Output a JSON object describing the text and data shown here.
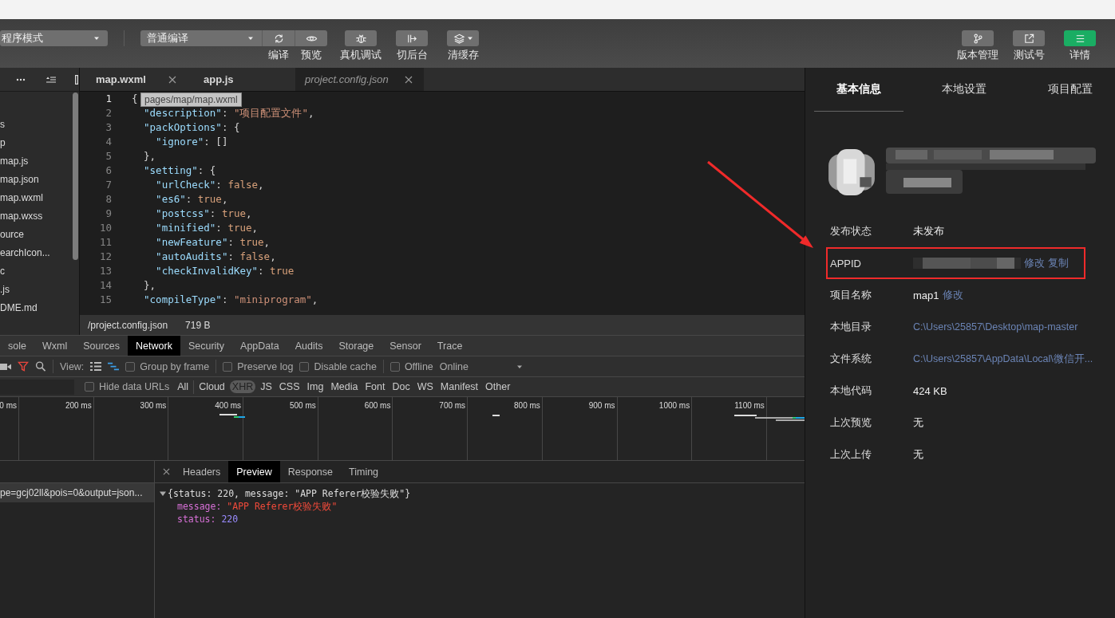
{
  "toolbar": {
    "mode_select": {
      "value": "程序模式"
    },
    "compile_select": {
      "value": "普通编译",
      "buttons": [
        {
          "label": "编译",
          "kind": "refresh"
        },
        {
          "label": "预览",
          "kind": "eye"
        }
      ]
    },
    "tools": [
      {
        "label": "真机调试",
        "kind": "bug"
      },
      {
        "label": "切后台",
        "kind": "exit"
      },
      {
        "label": "清缓存",
        "kind": "layers"
      }
    ],
    "right_tools": [
      {
        "label": "版本管理",
        "kind": "branch",
        "selected": false
      },
      {
        "label": "测试号",
        "kind": "external",
        "selected": false
      },
      {
        "label": "详情",
        "kind": "menu",
        "selected": true
      }
    ]
  },
  "file_tree": {
    "items": [
      "s",
      "p",
      "map.js",
      "map.json",
      "map.wxml",
      "map.wxss",
      "ource",
      "earchIcon...",
      "c",
      ".js",
      "DME.md"
    ]
  },
  "editor": {
    "tabs": [
      {
        "label": "map.wxml",
        "selected": false,
        "preview": false,
        "closable": true
      },
      {
        "label": "app.js",
        "selected": false,
        "preview": false,
        "closable": false
      },
      {
        "label": "project.config.json",
        "selected": true,
        "preview": true,
        "closable": true
      }
    ],
    "tooltip": "pages/map/map.wxml",
    "lines": [
      {
        "number": "1",
        "active": true,
        "tokens": [
          {
            "kind": "punct",
            "text": "{"
          }
        ]
      },
      {
        "number": "2",
        "active": false,
        "tokens": [
          {
            "kind": "key",
            "text": "  \"description\""
          },
          {
            "kind": "punct",
            "text": ": "
          },
          {
            "kind": "string",
            "text": "\"项目配置文件\""
          },
          {
            "kind": "punct",
            "text": ","
          }
        ]
      },
      {
        "number": "3",
        "active": false,
        "tokens": [
          {
            "kind": "key",
            "text": "  \"packOptions\""
          },
          {
            "kind": "punct",
            "text": ": {"
          }
        ]
      },
      {
        "number": "4",
        "active": false,
        "tokens": [
          {
            "kind": "key",
            "text": "    \"ignore\""
          },
          {
            "kind": "punct",
            "text": ": []"
          }
        ]
      },
      {
        "number": "5",
        "active": false,
        "tokens": [
          {
            "kind": "punct",
            "text": "  },"
          }
        ]
      },
      {
        "number": "6",
        "active": false,
        "tokens": [
          {
            "kind": "key",
            "text": "  \"setting\""
          },
          {
            "kind": "punct",
            "text": ": {"
          }
        ]
      },
      {
        "number": "7",
        "active": false,
        "tokens": [
          {
            "kind": "key",
            "text": "    \"urlCheck\""
          },
          {
            "kind": "punct",
            "text": ": "
          },
          {
            "kind": "literal",
            "text": "false"
          },
          {
            "kind": "punct",
            "text": ","
          }
        ]
      },
      {
        "number": "8",
        "active": false,
        "tokens": [
          {
            "kind": "key",
            "text": "    \"es6\""
          },
          {
            "kind": "punct",
            "text": ": "
          },
          {
            "kind": "literal",
            "text": "true"
          },
          {
            "kind": "punct",
            "text": ","
          }
        ]
      },
      {
        "number": "9",
        "active": false,
        "tokens": [
          {
            "kind": "key",
            "text": "    \"postcss\""
          },
          {
            "kind": "punct",
            "text": ": "
          },
          {
            "kind": "literal",
            "text": "true"
          },
          {
            "kind": "punct",
            "text": ","
          }
        ]
      },
      {
        "number": "10",
        "active": false,
        "tokens": [
          {
            "kind": "key",
            "text": "    \"minified\""
          },
          {
            "kind": "punct",
            "text": ": "
          },
          {
            "kind": "literal",
            "text": "true"
          },
          {
            "kind": "punct",
            "text": ","
          }
        ]
      },
      {
        "number": "11",
        "active": false,
        "tokens": [
          {
            "kind": "key",
            "text": "    \"newFeature\""
          },
          {
            "kind": "punct",
            "text": ": "
          },
          {
            "kind": "literal",
            "text": "true"
          },
          {
            "kind": "punct",
            "text": ","
          }
        ]
      },
      {
        "number": "12",
        "active": false,
        "tokens": [
          {
            "kind": "key",
            "text": "    \"autoAudits\""
          },
          {
            "kind": "punct",
            "text": ": "
          },
          {
            "kind": "literal",
            "text": "false"
          },
          {
            "kind": "punct",
            "text": ","
          }
        ]
      },
      {
        "number": "13",
        "active": false,
        "tokens": [
          {
            "kind": "key",
            "text": "    \"checkInvalidKey\""
          },
          {
            "kind": "punct",
            "text": ": "
          },
          {
            "kind": "literal",
            "text": "true"
          }
        ]
      },
      {
        "number": "14",
        "active": false,
        "tokens": [
          {
            "kind": "punct",
            "text": "  },"
          }
        ]
      },
      {
        "number": "15",
        "active": false,
        "tokens": [
          {
            "kind": "key",
            "text": "  \"compileType\""
          },
          {
            "kind": "punct",
            "text": ": "
          },
          {
            "kind": "string",
            "text": "\"miniprogram\""
          },
          {
            "kind": "punct",
            "text": ","
          }
        ]
      }
    ],
    "status": {
      "path": "/project.config.json",
      "size": "719 B"
    }
  },
  "devtools": {
    "tabs": [
      {
        "label": "sole",
        "selected": false
      },
      {
        "label": "Wxml",
        "selected": false
      },
      {
        "label": "Sources",
        "selected": false
      },
      {
        "label": "Network",
        "selected": true
      },
      {
        "label": "Security",
        "selected": false
      },
      {
        "label": "AppData",
        "selected": false
      },
      {
        "label": "Audits",
        "selected": false
      },
      {
        "label": "Storage",
        "selected": false
      },
      {
        "label": "Sensor",
        "selected": false
      },
      {
        "label": "Trace",
        "selected": false
      }
    ],
    "network_toolbar": {
      "filter_active": true,
      "view_label": "View:",
      "views": [
        {
          "kind": "list",
          "selected": false
        },
        {
          "kind": "waterfall",
          "selected": true
        }
      ],
      "options": [
        {
          "label": "Group by frame",
          "checked": false
        },
        {
          "label": "Preserve log",
          "checked": false
        },
        {
          "label": "Disable cache",
          "checked": false
        },
        {
          "label": "Offline",
          "checked": false
        }
      ],
      "throttling": "Online"
    },
    "filter_bar": {
      "hide_data_urls": {
        "label": "Hide data URLs",
        "checked": false
      },
      "types": [
        {
          "label": "All",
          "selected": false
        },
        {
          "label": "Cloud",
          "selected": false
        },
        {
          "label": "XHR",
          "selected": true
        },
        {
          "label": "JS",
          "selected": false
        },
        {
          "label": "CSS",
          "selected": false
        },
        {
          "label": "Img",
          "selected": false
        },
        {
          "label": "Media",
          "selected": false
        },
        {
          "label": "Font",
          "selected": false
        },
        {
          "label": "Doc",
          "selected": false
        },
        {
          "label": "WS",
          "selected": false
        },
        {
          "label": "Manifest",
          "selected": false
        },
        {
          "label": "Other",
          "selected": false
        }
      ]
    },
    "timeline": {
      "ticks": [
        "0 ms",
        "200 ms",
        "300 ms",
        "400 ms",
        "500 ms",
        "600 ms",
        "700 ms",
        "800 ms",
        "900 ms",
        "1000 ms",
        "1100 ms"
      ]
    },
    "requests": [
      {
        "name": "pe=gcj02ll&pois=0&output=json...",
        "selected": true
      }
    ],
    "detail_tabs": [
      {
        "label": "Headers",
        "selected": false
      },
      {
        "label": "Preview",
        "selected": true
      },
      {
        "label": "Response",
        "selected": false
      },
      {
        "label": "Timing",
        "selected": false
      }
    ],
    "preview": {
      "summary": "{status: 220, message: \"APP Referer校验失败\"}",
      "expanded": true,
      "properties": [
        {
          "key": "message:",
          "value": "\"APP Referer校验失败\"",
          "kind": "string"
        },
        {
          "key": "status:",
          "value": "220",
          "kind": "number"
        }
      ]
    }
  },
  "details_panel": {
    "tabs": [
      {
        "label": "基本信息",
        "selected": true
      },
      {
        "label": "本地设置",
        "selected": false
      },
      {
        "label": "项目配置",
        "selected": false
      }
    ],
    "rows": [
      {
        "label": "发布状态",
        "kind": "text",
        "value": "未发布",
        "highlighted": false
      },
      {
        "label": "APPID",
        "kind": "blurred",
        "links": [
          "修改",
          "复制"
        ],
        "highlighted": true
      },
      {
        "label": "项目名称",
        "kind": "text",
        "value": "map1",
        "links": [
          "修改"
        ],
        "highlighted": false
      },
      {
        "label": "本地目录",
        "kind": "link",
        "value": "C:\\Users\\25857\\Desktop\\map-master",
        "highlighted": false
      },
      {
        "label": "文件系统",
        "kind": "link",
        "value": "C:\\Users\\25857\\AppData\\Local\\微信开...",
        "highlighted": false
      },
      {
        "label": "本地代码",
        "kind": "text",
        "value": "424 KB",
        "highlighted": false
      },
      {
        "label": "上次预览",
        "kind": "text",
        "value": "无",
        "highlighted": false
      },
      {
        "label": "上次上传",
        "kind": "text",
        "value": "无",
        "highlighted": false
      }
    ]
  }
}
